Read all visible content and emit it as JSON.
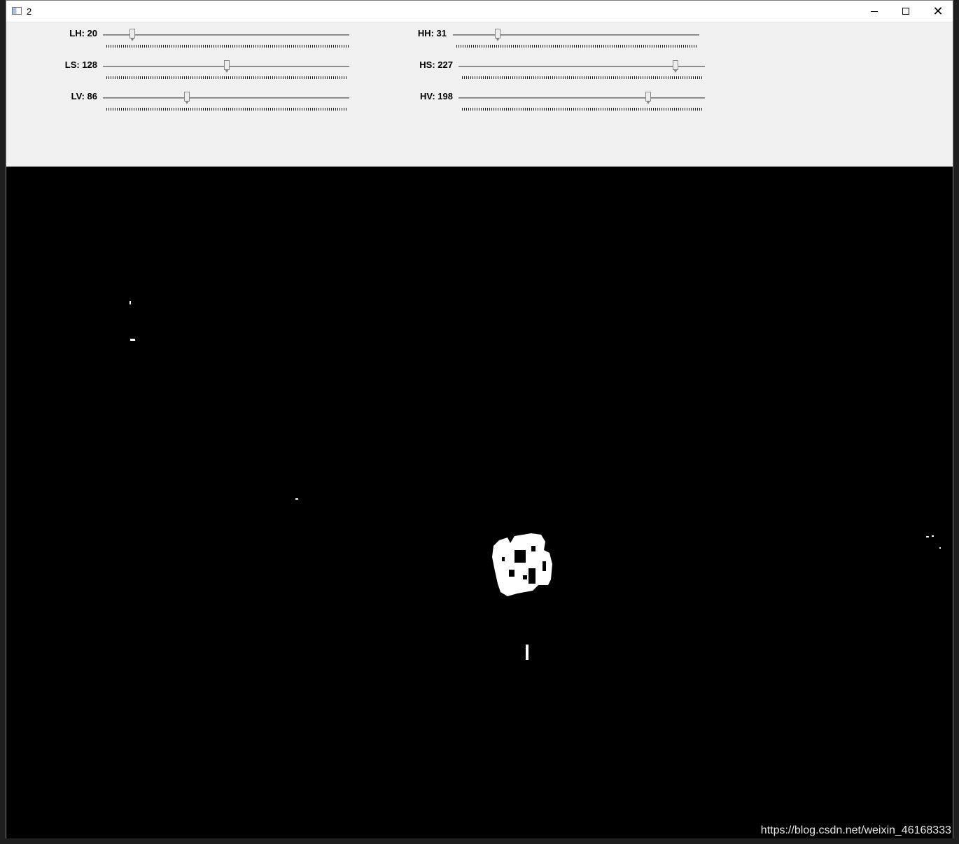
{
  "window": {
    "title": "2",
    "controls": {
      "minimize": "minimize",
      "maximize": "maximize",
      "close": "✕"
    }
  },
  "trackbars": [
    {
      "id": "lh",
      "label": "LH: 20",
      "value": 20,
      "max": 179
    },
    {
      "id": "hh",
      "label": "HH: 31",
      "value": 31,
      "max": 179
    },
    {
      "id": "ls",
      "label": "LS: 128",
      "value": 128,
      "max": 255
    },
    {
      "id": "hs",
      "label": "HS: 227",
      "value": 227,
      "max": 255
    },
    {
      "id": "lv",
      "label": "LV: 86",
      "value": 86,
      "max": 255
    },
    {
      "id": "hv",
      "label": "HV: 198",
      "value": 198,
      "max": 255
    }
  ],
  "watermark": "https://blog.csdn.net/weixin_46168333",
  "colors": {
    "image_background": "#000000",
    "mask_foreground": "#ffffff",
    "panel": "#f0f0f0"
  }
}
